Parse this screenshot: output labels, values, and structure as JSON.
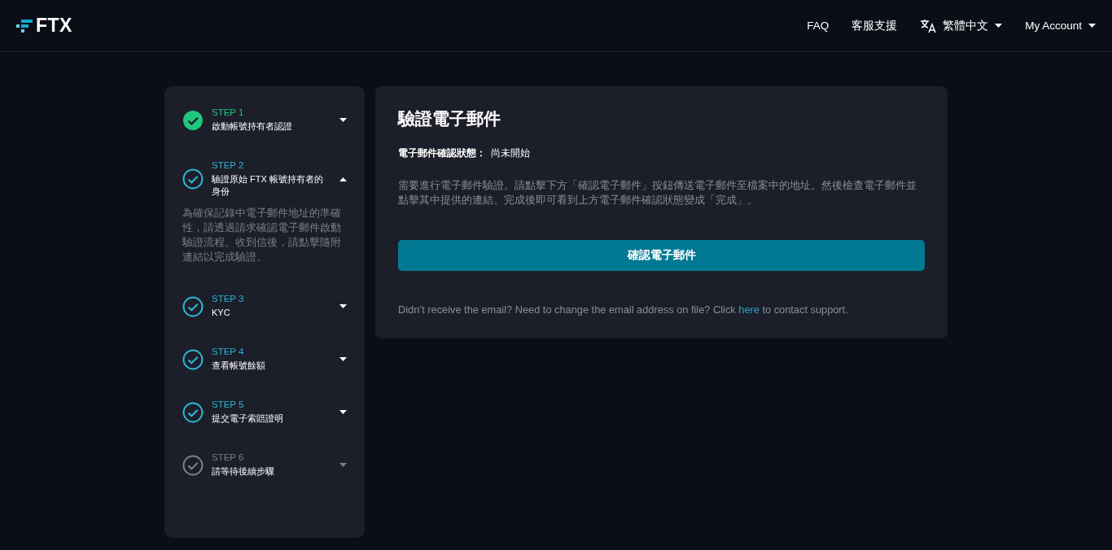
{
  "header": {
    "logo": "FTX",
    "nav": [
      {
        "kind": "link",
        "label": "FAQ"
      },
      {
        "kind": "link",
        "label": "客服支援"
      },
      {
        "kind": "language",
        "label": "繁體中文"
      },
      {
        "kind": "menu",
        "label": "My Account"
      }
    ]
  },
  "steps": [
    {
      "label": "STEP 1",
      "title": "啟動帳號持有者認證",
      "kind": "done",
      "expanded": false
    },
    {
      "label": "STEP 2",
      "title": "驗證原始 FTX 帳號持有者的身份",
      "kind": "active",
      "expanded": true,
      "description": "為確保記錄中電子郵件地址的準確性，請透過請求確認電子郵件啟動驗證流程。收到信後，請點擊隨附連結以完成驗證。"
    },
    {
      "label": "STEP 3",
      "title": "KYC",
      "kind": "active",
      "expanded": false
    },
    {
      "label": "STEP 4",
      "title": "查看帳號餘額",
      "kind": "active",
      "expanded": false
    },
    {
      "label": "STEP 5",
      "title": "提交電子索賠證明",
      "kind": "active",
      "expanded": false
    },
    {
      "label": "STEP 6",
      "title": "請等待後續步驟",
      "kind": "pending",
      "expanded": false
    }
  ],
  "panel": {
    "title": "驗證電子郵件",
    "status_label": "電子郵件確認狀態：",
    "status_value": "尚未開始",
    "instructions": "需要進行電子郵件驗證。請點擊下方「確認電子郵件」按鈕傳送電子郵件至檔案中的地址。然後檢查電子郵件並點擊其中提供的連結。完成後即可看到上方電子郵件確認狀態變成「完成」。",
    "button": "確認電子郵件",
    "support_note": {
      "before": "Didn’t receive the email? Need to change the email address on file? Click",
      "link": "here",
      "after": "to contact support."
    }
  }
}
